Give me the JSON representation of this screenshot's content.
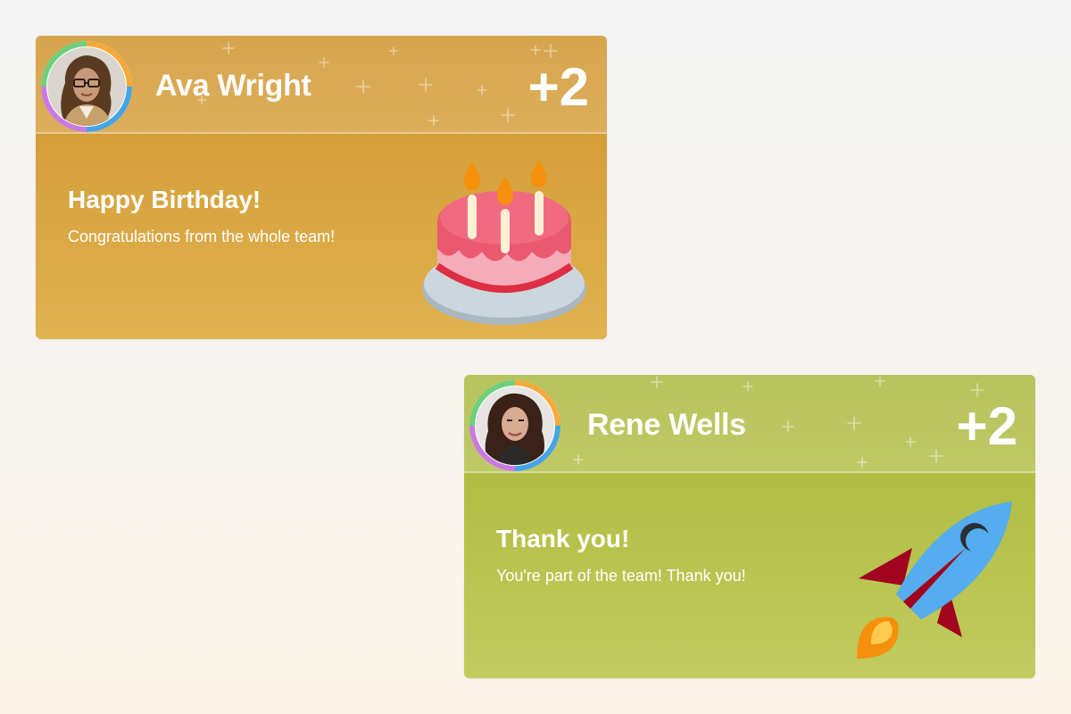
{
  "cards": [
    {
      "name": "Ava Wright",
      "count": "+2",
      "title": "Happy Birthday!",
      "message": "Congratulations from the whole team!",
      "illustration": "birthday-cake-icon",
      "accent": "#d39a32"
    },
    {
      "name": "Rene Wells",
      "count": "+2",
      "title": "Thank you!",
      "message": "You're part of the team! Thank you!",
      "illustration": "rocket-icon",
      "accent": "#b1bd45"
    }
  ],
  "avatar_ring_colors": [
    "#f5a93b",
    "#44a4e6",
    "#c97be0",
    "#6fcf7c"
  ]
}
